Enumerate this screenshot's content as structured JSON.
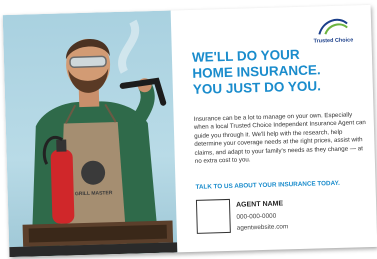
{
  "headline": {
    "line1": "WE'LL DO YOUR",
    "line2": "HOME INSURANCE.",
    "line3": "YOU JUST DO YOU."
  },
  "body": "Insurance can be a lot to manage on your own. Especially when a local Trusted Choice Independent Insurance Agent can guide you through it. We'll help with the research, help determine your coverage needs at the right prices, assist with claims, and adapt to your family's needs as they change — at no extra cost to you.",
  "cta": "TALK TO US ABOUT YOUR INSURANCE TODAY.",
  "agent": {
    "name": "AGENT NAME",
    "phone": "000-000-0000",
    "website": "agentwebsite.com"
  },
  "logo": {
    "text": "Trusted Choice",
    "icon": "trusted-choice-swoosh-icon"
  },
  "apron_text": "GRILL MASTER",
  "colors": {
    "accent": "#1a8ccc",
    "logo": "#1b3f8a",
    "sky": "#b3d8e5",
    "extinguisher": "#d0272a",
    "apron": "#a58e71",
    "shirt": "#2f6a4a"
  }
}
